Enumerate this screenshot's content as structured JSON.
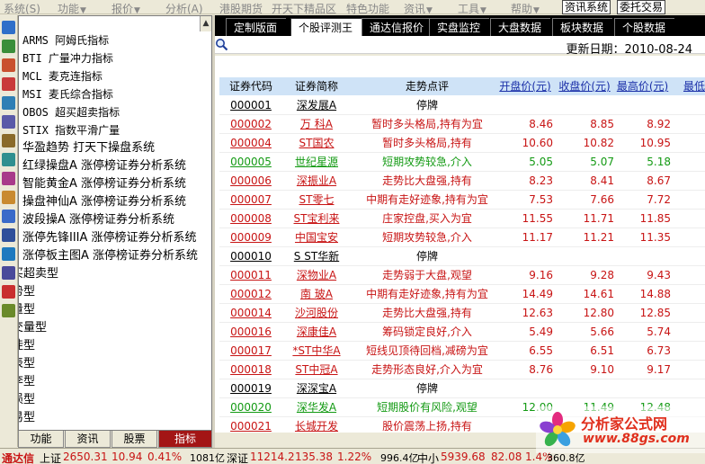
{
  "menu": {
    "items": [
      {
        "label": "系统(S)",
        "has_arrow": false
      },
      {
        "label": "功能",
        "has_arrow": true
      },
      {
        "label": "报价",
        "has_arrow": true
      },
      {
        "label": "分析(A)",
        "has_arrow": false
      },
      {
        "label": "港股期货",
        "has_arrow": false
      },
      {
        "label": "开天下精品区",
        "has_arrow": false
      },
      {
        "label": "特色功能",
        "has_arrow": false
      },
      {
        "label": "资讯",
        "has_arrow": true
      },
      {
        "label": "工具",
        "has_arrow": true
      },
      {
        "label": "帮助",
        "has_arrow": true
      }
    ],
    "info_system_button": "资讯系统",
    "trade_button": "委托交易"
  },
  "toolbar_icons": [
    "quote-list-icon",
    "multi-window-icon",
    "trend-chart-icon",
    "kline-icon",
    "table-icon",
    "list-icon",
    "doc-icon",
    "grid-icon",
    "calc-icon",
    "mail-icon",
    "info-icon",
    "tv-icon",
    "search-icon",
    "etf-icon",
    "link-icon",
    "palette-icon"
  ],
  "formula_list": [
    {
      "text": "ARMS 阿姆氏指标",
      "mono": true
    },
    {
      "text": "BTI 广量冲力指标",
      "mono": true
    },
    {
      "text": "MCL 麦克连指标",
      "mono": true
    },
    {
      "text": "MSI 麦氏综合指标",
      "mono": true
    },
    {
      "text": "OBOS 超买超卖指标",
      "mono": true
    },
    {
      "text": "STIX 指数平滑广量",
      "mono": true
    },
    {
      "text": "华盈趋势 打天下操盘系统",
      "mono": false
    },
    {
      "text": "红绿操盘A 涨停榜证券分析系统",
      "mono": false
    },
    {
      "text": "智能黄金A 涨停榜证券分析系统",
      "mono": false
    },
    {
      "text": "操盘神仙A 涨停榜证券分析系统",
      "mono": false
    },
    {
      "text": "波段操A 涨停榜证券分析系统",
      "mono": false
    },
    {
      "text": "涨停先锋IIIA 涨停榜证券分析系统",
      "mono": false
    },
    {
      "text": "涨停板主图A 涨停榜证券分析系统",
      "mono": false
    },
    {
      "text": "买超卖型",
      "mono": false,
      "clip": true
    },
    {
      "text": "势型",
      "mono": false,
      "clip": true
    },
    {
      "text": "量型",
      "mono": false,
      "clip": true
    },
    {
      "text": "交量型",
      "mono": false,
      "clip": true
    },
    {
      "text": "徒型",
      "mono": false,
      "clip": true
    },
    {
      "text": "表型",
      "mono": false,
      "clip": true
    },
    {
      "text": "李型",
      "mono": false,
      "clip": true
    },
    {
      "text": "损型",
      "mono": false,
      "clip": true
    },
    {
      "text": "易型",
      "mono": false,
      "clip": true
    }
  ],
  "left_tabs": [
    {
      "label": "功能",
      "active": false
    },
    {
      "label": "资讯",
      "active": false
    },
    {
      "label": "股票",
      "active": false
    },
    {
      "label": "指标",
      "active": true
    }
  ],
  "main_tabs": [
    {
      "label": "定制版面",
      "active": false
    },
    {
      "label": "个股评测王",
      "active": true
    },
    {
      "label": "通达信报价",
      "active": false
    },
    {
      "label": "实盘监控",
      "active": false
    },
    {
      "label": "大盘数据",
      "active": false
    },
    {
      "label": "板块数据",
      "active": false
    },
    {
      "label": "个股数据",
      "active": false
    }
  ],
  "update_date": "更新日期：2010-08-24",
  "table": {
    "headers": {
      "code": "证券代码",
      "name": "证券简称",
      "trend": "走势点评",
      "open": "开盘价(元)",
      "close": "收盘价(元)",
      "high": "最高价(元)",
      "low": "最低"
    },
    "rows": [
      {
        "code": "000001",
        "name": "深发展A",
        "trend": "停牌",
        "open": "",
        "close": "",
        "high": "",
        "color": "black"
      },
      {
        "code": "000002",
        "name": "万 科A",
        "trend": "暂时多头格局,持有为宜",
        "open": "8.46",
        "close": "8.85",
        "high": "8.92",
        "color": "red"
      },
      {
        "code": "000004",
        "name": "ST国农",
        "trend": "暂时多头格局,持有",
        "open": "10.60",
        "close": "10.82",
        "high": "10.95",
        "color": "red"
      },
      {
        "code": "000005",
        "name": "世纪星源",
        "trend": "短期攻势较急,介入",
        "open": "5.05",
        "close": "5.07",
        "high": "5.18",
        "color": "green"
      },
      {
        "code": "000006",
        "name": "深振业A",
        "trend": "走势比大盘强,持有",
        "open": "8.23",
        "close": "8.41",
        "high": "8.67",
        "color": "red"
      },
      {
        "code": "000007",
        "name": "ST零七",
        "trend": "中期有走好迹象,持有为宜",
        "open": "7.53",
        "close": "7.66",
        "high": "7.72",
        "color": "red"
      },
      {
        "code": "000008",
        "name": "ST宝利来",
        "trend": "庄家控盘,买入为宜",
        "open": "11.55",
        "close": "11.71",
        "high": "11.85",
        "color": "red"
      },
      {
        "code": "000009",
        "name": "中国宝安",
        "trend": "短期攻势较急,介入",
        "open": "11.17",
        "close": "11.21",
        "high": "11.35",
        "color": "red"
      },
      {
        "code": "000010",
        "name": "S ST华新",
        "trend": "停牌",
        "open": "",
        "close": "",
        "high": "",
        "color": "black"
      },
      {
        "code": "000011",
        "name": "深物业A",
        "trend": "走势弱于大盘,观望",
        "open": "9.16",
        "close": "9.28",
        "high": "9.43",
        "color": "red"
      },
      {
        "code": "000012",
        "name": "南 玻A",
        "trend": "中期有走好迹象,持有为宜",
        "open": "14.49",
        "close": "14.61",
        "high": "14.88",
        "color": "red"
      },
      {
        "code": "000014",
        "name": "沙河股份",
        "trend": "走势比大盘强,持有",
        "open": "12.63",
        "close": "12.80",
        "high": "12.85",
        "color": "red"
      },
      {
        "code": "000016",
        "name": "深康佳A",
        "trend": "筹码锁定良好,介入",
        "open": "5.49",
        "close": "5.66",
        "high": "5.74",
        "color": "red"
      },
      {
        "code": "000017",
        "name": "*ST中华A",
        "trend": "短线见顶待回档,减磅为宜",
        "open": "6.55",
        "close": "6.51",
        "high": "6.73",
        "color": "red"
      },
      {
        "code": "000018",
        "name": "ST中冠A",
        "trend": "走势形态良好,介入为宜",
        "open": "8.76",
        "close": "9.10",
        "high": "9.17",
        "color": "red"
      },
      {
        "code": "000019",
        "name": "深深宝A",
        "trend": "停牌",
        "open": "",
        "close": "",
        "high": "",
        "color": "black"
      },
      {
        "code": "000020",
        "name": "深华发A",
        "trend": "短期股价有风险,观望",
        "open": "12.00",
        "close": "11.49",
        "high": "12.48",
        "color": "green"
      },
      {
        "code": "000021",
        "name": "长城开发",
        "trend": "股价震荡上扬,持有",
        "open": "1",
        "close": "",
        "high": "",
        "color": "red"
      }
    ]
  },
  "status": {
    "brand": "通达信",
    "sh_label": "上证",
    "sh_value": "2650.31",
    "sh_change": "10.94",
    "sh_pct": "0.41%",
    "sh_amount": "1081亿",
    "sz_label": "深证",
    "sz_value": "11214.2",
    "sz_change": "135.38",
    "sz_pct": "1.22%",
    "sz_amount": "996.4亿",
    "zx_label": "中小",
    "zx_value": "5939.68",
    "zx_change": "82.08",
    "zx_pct": "1.4%",
    "zx_amount": "360.8亿"
  },
  "watermark": {
    "title": "分析家公式网",
    "url": "www.88gs.com"
  },
  "colors": {
    "red": "#c81414",
    "green": "#139a13",
    "active_left_tab": "#a31515",
    "header_row": "#cfe3f7"
  }
}
